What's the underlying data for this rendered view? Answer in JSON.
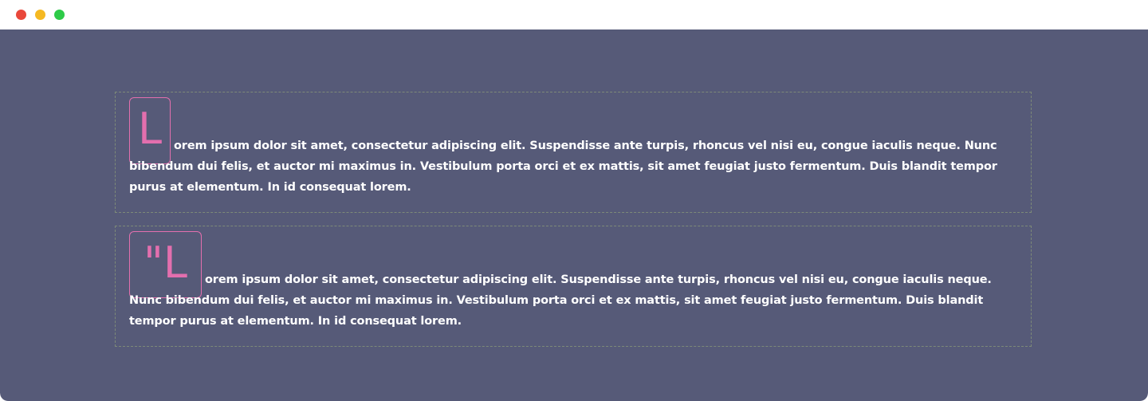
{
  "window": {
    "controls": [
      "close",
      "minimize",
      "maximize"
    ],
    "colors": {
      "close": "#e9483b",
      "minimize": "#f5b922",
      "maximize": "#2ecb48",
      "background": "#565a78",
      "accent": "#e36fae",
      "border": "#7d8a78"
    }
  },
  "cards": [
    {
      "dropcap": "L",
      "text": "orem ipsum dolor sit amet, consectetur adipiscing elit. Suspendisse ante turpis, rhoncus vel nisi eu, congue iaculis neque. Nunc bibendum dui felis, et auctor mi maximus in. Vestibulum porta orci et ex mattis, sit amet feugiat justo fermentum. Duis blandit tempor purus at elementum. In id consequat lorem."
    },
    {
      "dropcap": "\"L",
      "text": "orem ipsum dolor sit amet, consectetur adipiscing elit. Suspendisse ante turpis, rhoncus vel nisi eu, congue iaculis neque. Nunc bibendum dui felis, et auctor mi maximus in. Vestibulum porta orci et ex mattis, sit amet feugiat justo fermentum. Duis blandit tempor purus at elementum. In id consequat lorem."
    }
  ]
}
